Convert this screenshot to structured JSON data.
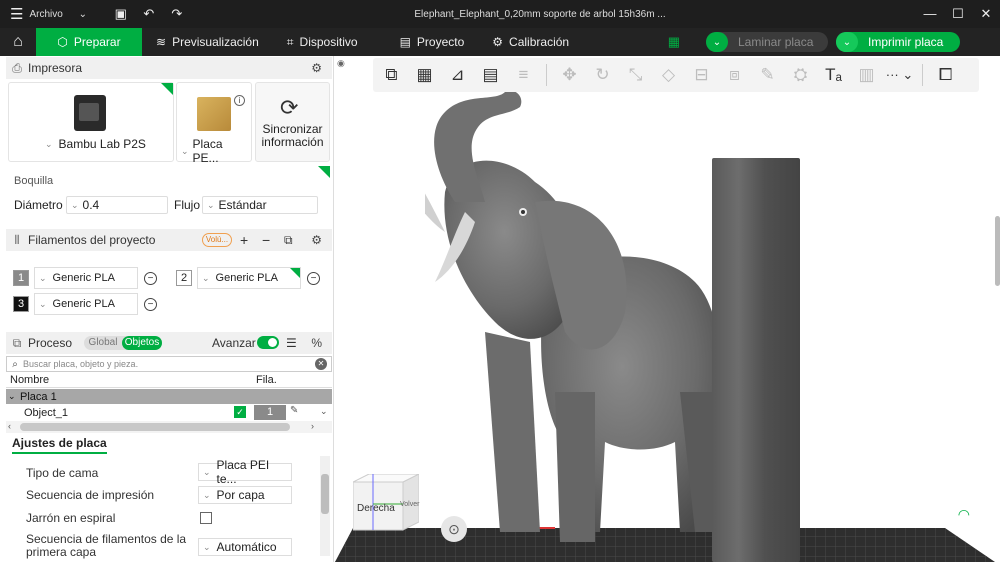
{
  "titlebar": {
    "menu_label": "Archivo",
    "title": "Elephant_Elephant_0,20mm soporte de arbol 15h36m ..."
  },
  "nav": {
    "tabs": [
      {
        "label": "Preparar"
      },
      {
        "label": "Previsualización"
      },
      {
        "label": "Dispositivo"
      },
      {
        "label": "Proyecto"
      },
      {
        "label": "Calibración"
      }
    ],
    "slice_label": "Laminar placa",
    "print_label": "Imprimir placa"
  },
  "printer": {
    "section_title": "Impresora",
    "printer_name": "Bambu Lab P2S",
    "plate_name": "Placa PE...",
    "sync_label": "Sincronizar información",
    "nozzle_label": "Boquilla",
    "diameter_label": "Diámetro",
    "diameter_value": "0.4",
    "flow_label": "Flujo",
    "flow_value": "Estándar"
  },
  "filaments": {
    "section_title": "Filamentos del proyecto",
    "badge": "Volú...",
    "items": [
      {
        "num": "1",
        "name": "Generic PLA"
      },
      {
        "num": "2",
        "name": "Generic PLA"
      },
      {
        "num": "3",
        "name": "Generic PLA"
      }
    ]
  },
  "process": {
    "section_title": "Proceso",
    "seg_global": "Global",
    "seg_objects": "Objetos",
    "advanced_label": "Avanzar",
    "search_placeholder": "Buscar placa, objeto y pieza.",
    "col_name": "Nombre",
    "col_fila": "Fila.",
    "plate_row": "Placa 1",
    "object_row": "Object_1",
    "object_filament": "1"
  },
  "plate_settings": {
    "tab_label": "Ajustes de placa",
    "rows": [
      {
        "label": "Tipo de cama",
        "value": "Placa PEI te..."
      },
      {
        "label": "Secuencia de impresión",
        "value": "Por capa"
      },
      {
        "label": "Jarrón en espiral",
        "value": ""
      },
      {
        "label": "Secuencia de filamentos de la primera capa",
        "value": "Automático"
      }
    ]
  },
  "viewport": {
    "cube_front": "Derecha",
    "cube_side": "Volver"
  },
  "colors": {
    "accent": "#00ae42",
    "titlebar": "#1e1e1e",
    "navbar": "#232323",
    "model": "#6b6b6b"
  }
}
